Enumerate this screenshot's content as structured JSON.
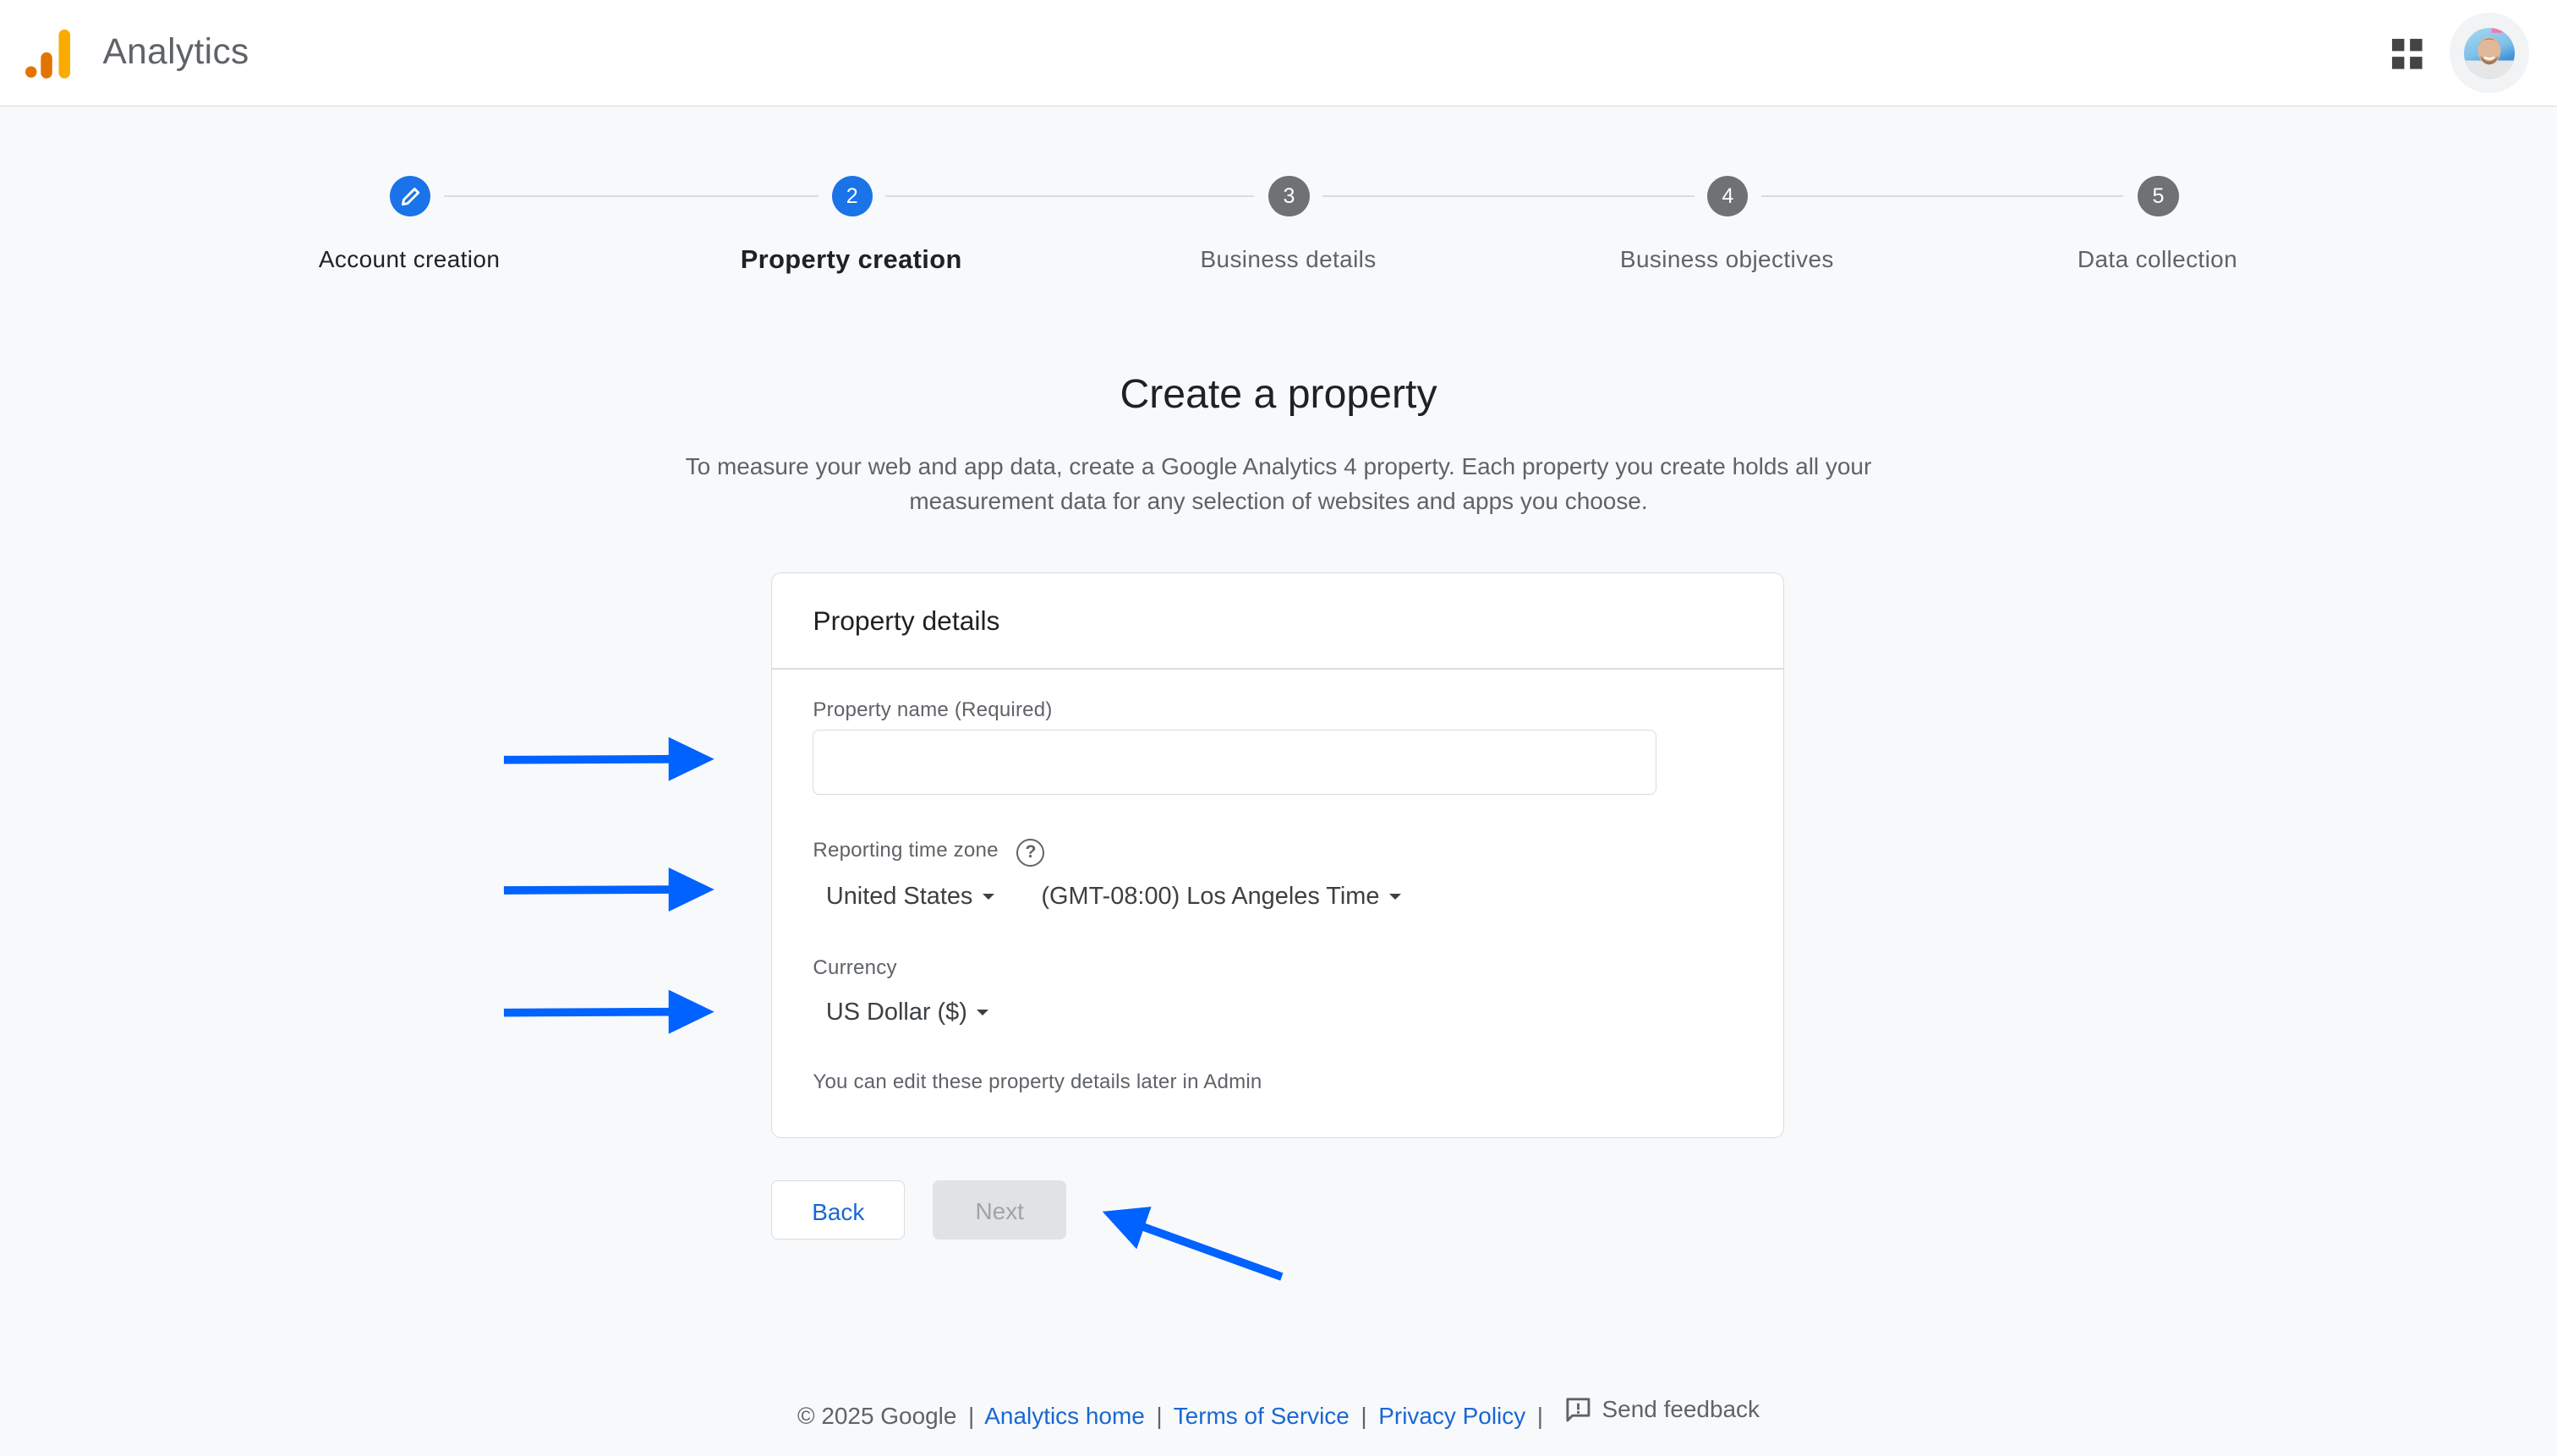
{
  "header": {
    "app_title": "Analytics",
    "logo_icon": "analytics-logo-icon",
    "apps_icon": "apps-grid-icon",
    "avatar_alt": "account-avatar"
  },
  "stepper": {
    "steps": [
      {
        "number": "",
        "icon": "pencil-icon",
        "label": "Account creation",
        "state": "completed"
      },
      {
        "number": "2",
        "label": "Property creation",
        "state": "current"
      },
      {
        "number": "3",
        "label": "Business details",
        "state": "upcoming"
      },
      {
        "number": "4",
        "label": "Business objectives",
        "state": "upcoming"
      },
      {
        "number": "5",
        "label": "Data collection",
        "state": "upcoming"
      }
    ]
  },
  "main": {
    "title": "Create a property",
    "description": "To measure your web and app data, create a Google Analytics 4 property. Each property you create holds all your measurement data for any selection of websites and apps you choose."
  },
  "card": {
    "title": "Property details",
    "property_name": {
      "label": "Property name (Required)",
      "value": "",
      "placeholder": ""
    },
    "time_zone": {
      "label": "Reporting time zone",
      "help_icon": "help-circle-icon",
      "country": "United States",
      "zone": "(GMT-08:00) Los Angeles Time"
    },
    "currency": {
      "label": "Currency",
      "value": "US Dollar ($)"
    },
    "note": "You can edit these property details later in Admin"
  },
  "buttons": {
    "back": "Back",
    "next": "Next",
    "next_disabled": true
  },
  "footer": {
    "copyright": "© 2025 Google",
    "links": [
      "Analytics home",
      "Terms of Service",
      "Privacy Policy"
    ],
    "separator": "|",
    "feedback": "Send feedback"
  },
  "colors": {
    "accent": "#1a73e8",
    "link": "#1967d2",
    "step_inactive": "#6f7173",
    "annotation_arrow": "#0062ff",
    "logo_orange_dark": "#e37400",
    "logo_orange_light": "#f9ab00"
  }
}
